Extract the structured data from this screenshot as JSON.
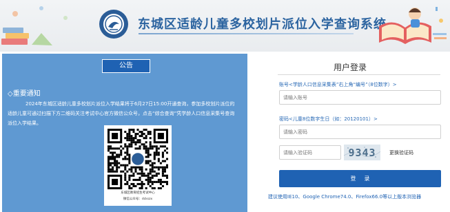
{
  "header": {
    "site_title": "东城区适龄儿童多校划片派位入学查询系统"
  },
  "notice": {
    "tab_label": "公告",
    "heading": "◇重要通知",
    "body": "2024年东城区适龄儿童多校划片派位入学结果将于6月27日15:00开通查询，参加多校划片派位的适龄儿童可通过扫描下方二维码关注考试中心官方微信公众号，点击“综合查询”凭学龄人口信息采集号查询派位入学结果。",
    "qr_caption_line1": "东城区教育招生考试中心",
    "qr_caption_line2": "微信公众号：dckszx"
  },
  "login": {
    "title": "用户登录",
    "account_label": "账号<学龄人口信息采集表”右上角“编号”（8位数字）>",
    "account_placeholder": "请输入账号",
    "password_label": "密码<儿童8位数字生日（如：20120101）>",
    "password_placeholder": "请输入密码",
    "captcha_placeholder": "请输入验证码",
    "captcha_text": "9343",
    "refresh_captcha_label": "更换验证码",
    "login_button_label": "登录",
    "browser_note": "建议使用IE10、Google Chrome74.0、Firefox66.0等以上版本浏览器"
  },
  "colors": {
    "header_title": "#2c64a0",
    "notice_panel": "#5f99d2",
    "primary_button": "#1f62b3",
    "field_label": "#2567b4"
  }
}
